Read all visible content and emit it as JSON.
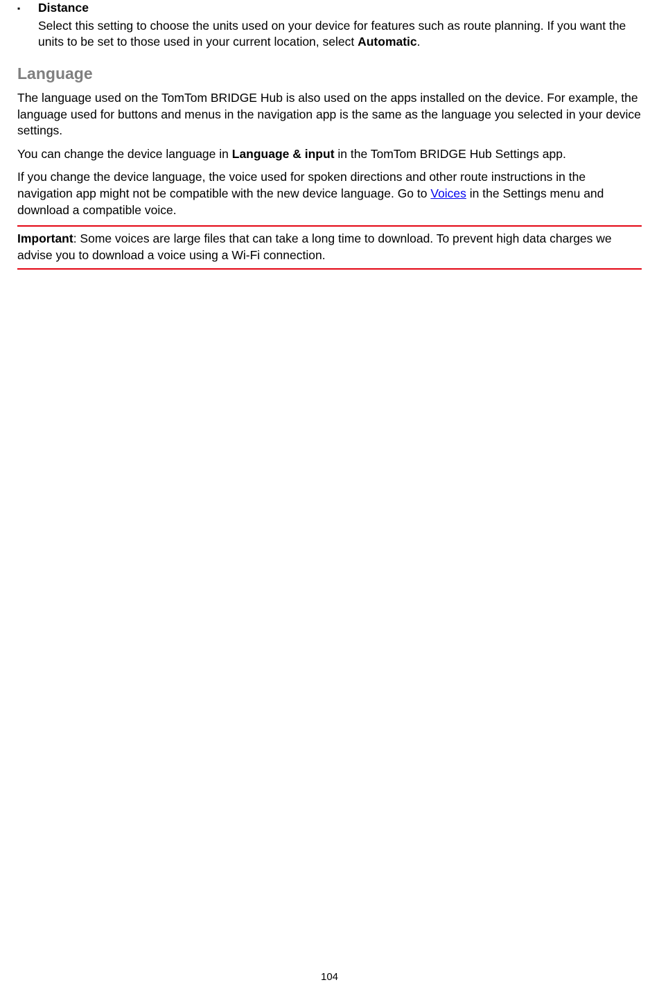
{
  "distance": {
    "heading": "Distance",
    "text_part1": "Select this setting to choose the units used on your device for features such as route planning. If you want the units to be set to those used in your current location, select ",
    "text_bold": "Automatic",
    "text_part2": "."
  },
  "language": {
    "heading": "Language",
    "para1": "The language used on the TomTom BRIDGE Hub is also used on the apps installed on the device. For example, the language used for buttons and menus in the navigation app is the same as the language you selected in your device settings.",
    "para2_part1": "You can change the device language in ",
    "para2_bold": "Language & input",
    "para2_part2": " in the TomTom BRIDGE Hub Settings app.",
    "para3_part1": "If you change the device language, the voice used for spoken directions and other route instructions in the navigation app might not be compatible with the new device language. Go to ",
    "para3_link": "Voices",
    "para3_part2": " in the Settings menu and download a compatible voice."
  },
  "important": {
    "label": "Important",
    "text": ": Some voices are large files that can take a long time to download. To prevent high data charges we advise you to download a voice using a Wi-Fi connection."
  },
  "pageNumber": "104"
}
